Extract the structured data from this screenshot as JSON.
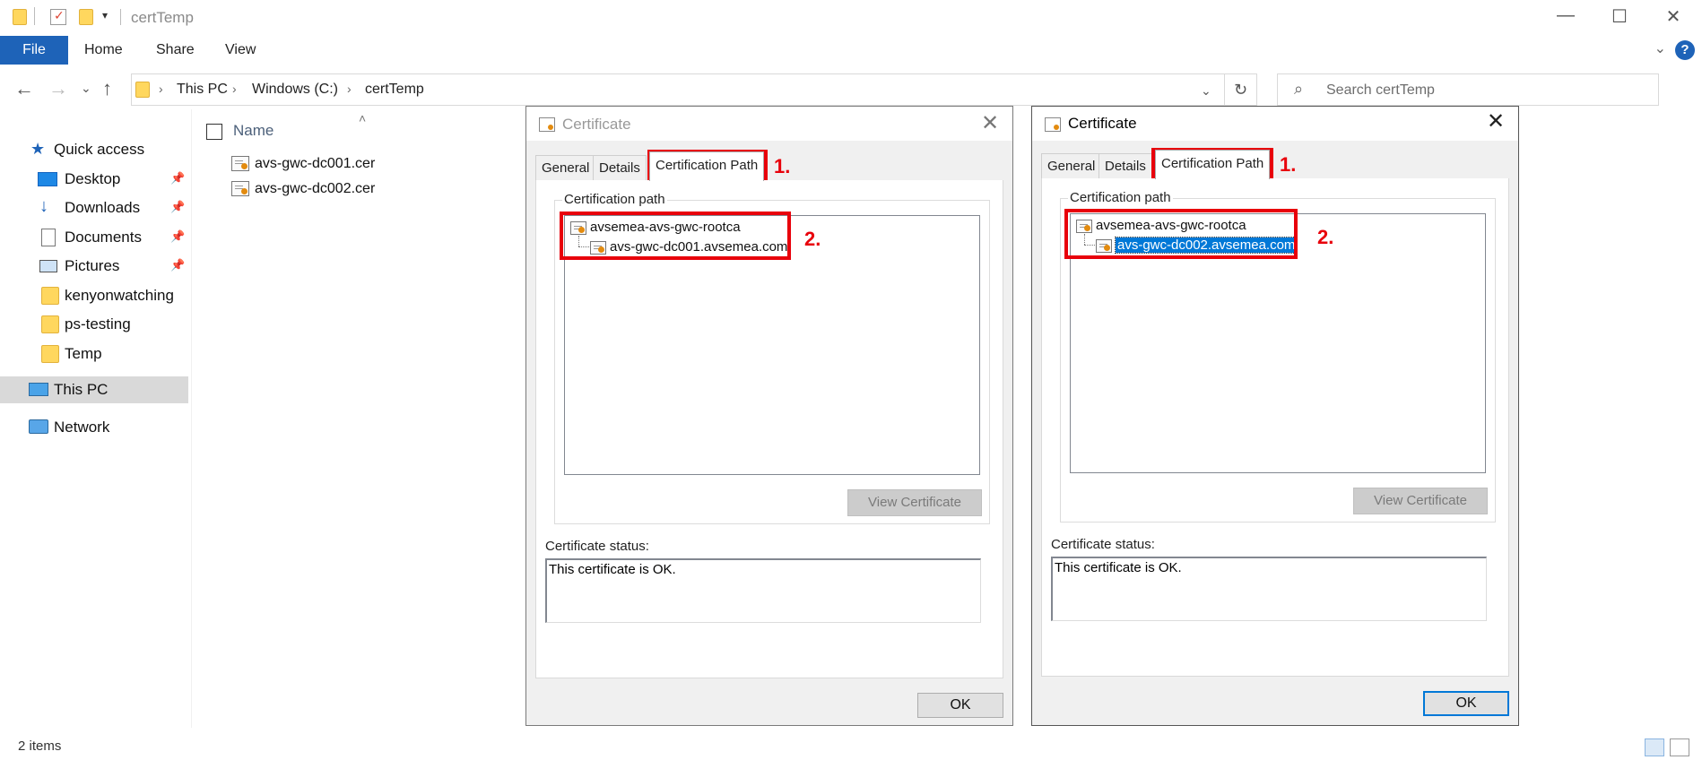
{
  "window": {
    "title": "certTemp",
    "minimize_icon": "minimize-icon",
    "maximize_icon": "maximize-icon",
    "close_icon": "close-icon"
  },
  "ribbon": {
    "tabs": [
      "File",
      "Home",
      "Share",
      "View"
    ],
    "help": "?"
  },
  "address": {
    "breadcrumbs": [
      "This PC",
      "Windows (C:)",
      "certTemp"
    ],
    "search_placeholder": "Search certTemp"
  },
  "nav": {
    "quick_access": "Quick access",
    "items": [
      {
        "label": "Desktop",
        "icon": "desktop-icon",
        "pinned": true
      },
      {
        "label": "Downloads",
        "icon": "download-icon",
        "pinned": true
      },
      {
        "label": "Documents",
        "icon": "document-icon",
        "pinned": true
      },
      {
        "label": "Pictures",
        "icon": "pictures-icon",
        "pinned": true
      },
      {
        "label": "kenyonwatching",
        "icon": "folder-icon",
        "pinned": false
      },
      {
        "label": "ps-testing",
        "icon": "folder-icon",
        "pinned": false
      },
      {
        "label": "Temp",
        "icon": "folder-icon",
        "pinned": false
      }
    ],
    "this_pc": "This PC",
    "network": "Network"
  },
  "files": {
    "column_name": "Name",
    "rows": [
      "avs-gwc-dc001.cer",
      "avs-gwc-dc002.cer"
    ]
  },
  "status": {
    "items_count": "2 items"
  },
  "dialogs": [
    {
      "title": "Certificate",
      "tabs": [
        "General",
        "Details",
        "Certification Path"
      ],
      "active_tab": "Certification Path",
      "group_label": "Certification path",
      "root": "avsemea-avs-gwc-rootca",
      "child": "avs-gwc-dc001.avsemea.com",
      "child_selected": false,
      "view_button": "View Certificate",
      "status_label": "Certificate status:",
      "status_text": "This certificate is OK.",
      "ok": "OK",
      "annot1": "1.",
      "annot2": "2."
    },
    {
      "title": "Certificate",
      "tabs": [
        "General",
        "Details",
        "Certification Path"
      ],
      "active_tab": "Certification Path",
      "group_label": "Certification path",
      "root": "avsemea-avs-gwc-rootca",
      "child": "avs-gwc-dc002.avsemea.com",
      "child_selected": true,
      "view_button": "View Certificate",
      "status_label": "Certificate status:",
      "status_text": "This certificate is OK.",
      "ok": "OK",
      "annot1": "1.",
      "annot2": "2."
    }
  ],
  "colors": {
    "accent": "#1e63b8",
    "selection": "#0078d7",
    "annotation": "#e8000b",
    "folder": "#ffd75e"
  }
}
